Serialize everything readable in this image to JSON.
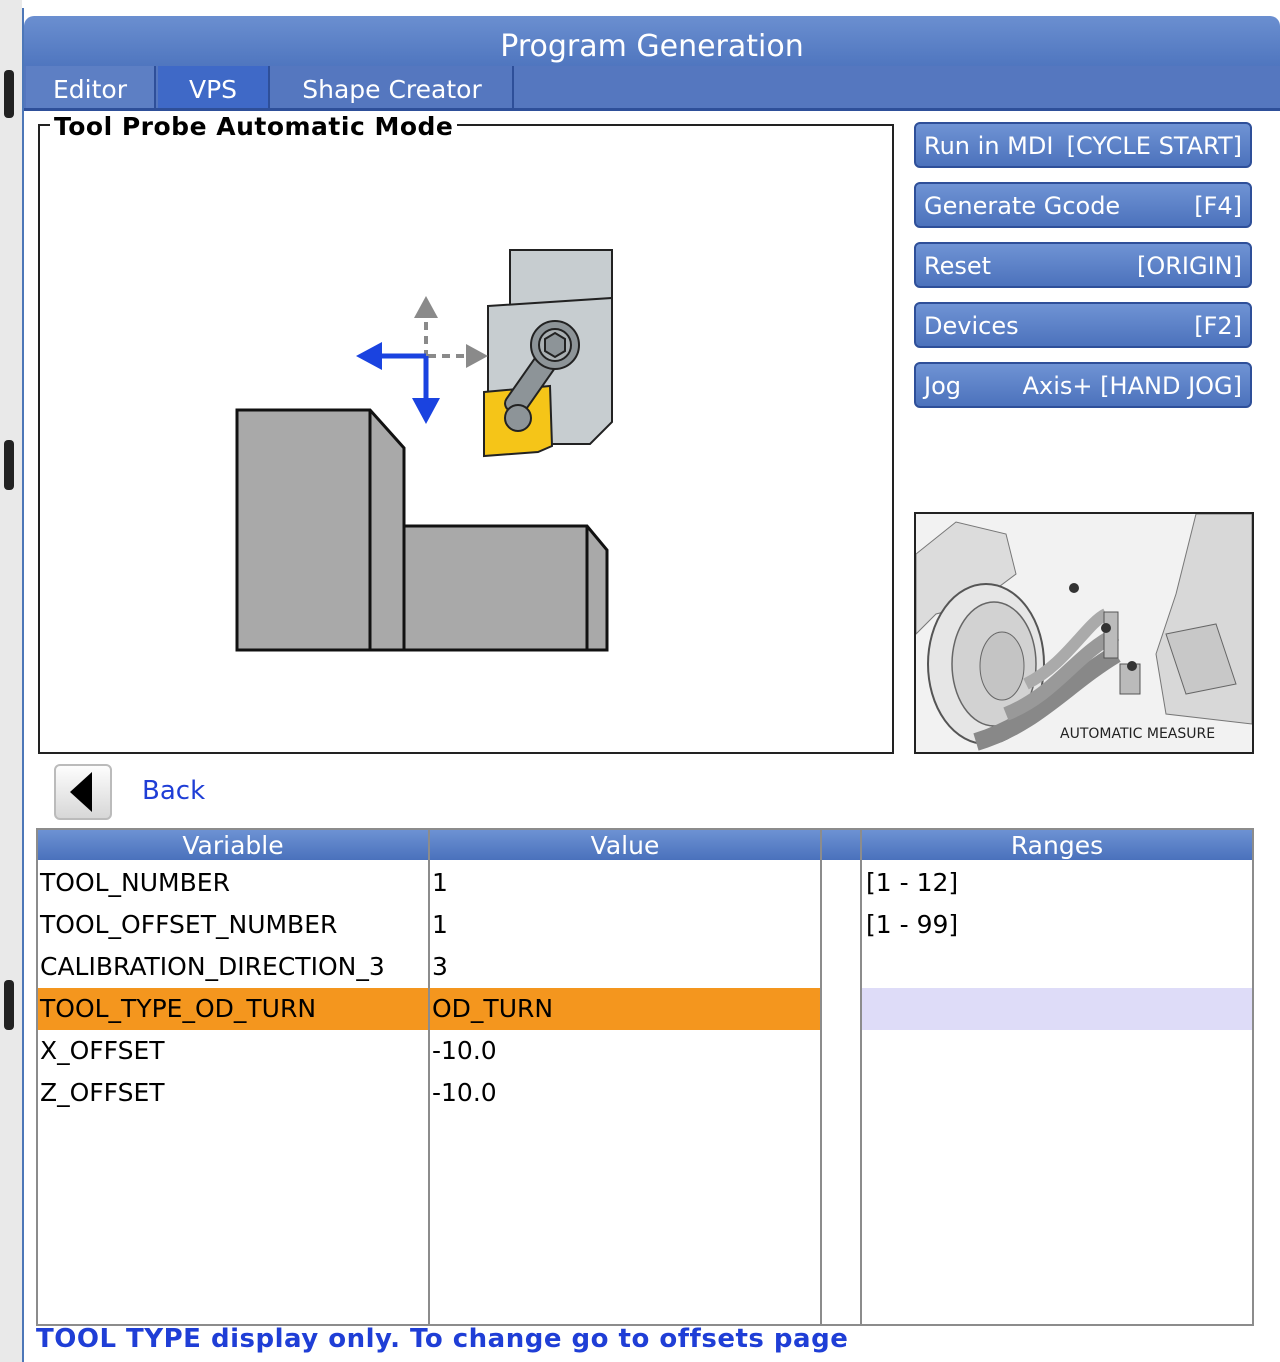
{
  "window": {
    "title": "Program Generation"
  },
  "tabs": [
    {
      "label": "Editor"
    },
    {
      "label": "VPS"
    },
    {
      "label": "Shape Creator"
    }
  ],
  "diagram": {
    "title": "Tool Probe Automatic Mode"
  },
  "actions": [
    {
      "label": "Run in MDI",
      "key": "[CYCLE START]"
    },
    {
      "label": "Generate Gcode",
      "key": "[F4]"
    },
    {
      "label": "Reset",
      "key": "[ORIGIN]"
    },
    {
      "label": "Devices",
      "key": "[F2]"
    },
    {
      "label": "Jog",
      "key": "Axis+ [HAND JOG]"
    }
  ],
  "thumbnail": {
    "caption": "AUTOMATIC MEASURE"
  },
  "back": {
    "label": "Back"
  },
  "table": {
    "headers": {
      "variable": "Variable",
      "value": "Value",
      "ranges": "Ranges"
    },
    "rows": [
      {
        "variable": "TOOL_NUMBER",
        "value": "1",
        "range": "[1 - 12]"
      },
      {
        "variable": "TOOL_OFFSET_NUMBER",
        "value": "1",
        "range": "[1 - 99]"
      },
      {
        "variable": "CALIBRATION_DIRECTION_3",
        "value": "3",
        "range": ""
      },
      {
        "variable": "TOOL_TYPE_OD_TURN",
        "value": "OD_TURN",
        "range": ""
      },
      {
        "variable": "X_OFFSET",
        "value": "-10.0",
        "range": ""
      },
      {
        "variable": "Z_OFFSET",
        "value": "-10.0",
        "range": ""
      }
    ],
    "selected_row": "TOOL_TYPE_OD_TURN"
  },
  "status": {
    "message": "TOOL TYPE display only. To change go to offsets page"
  },
  "colors": {
    "accent": "#4c73bd",
    "selection": "#f4961e",
    "link": "#1f3ed6",
    "arrow": "#1a43e0",
    "insert": "#f5c518"
  }
}
